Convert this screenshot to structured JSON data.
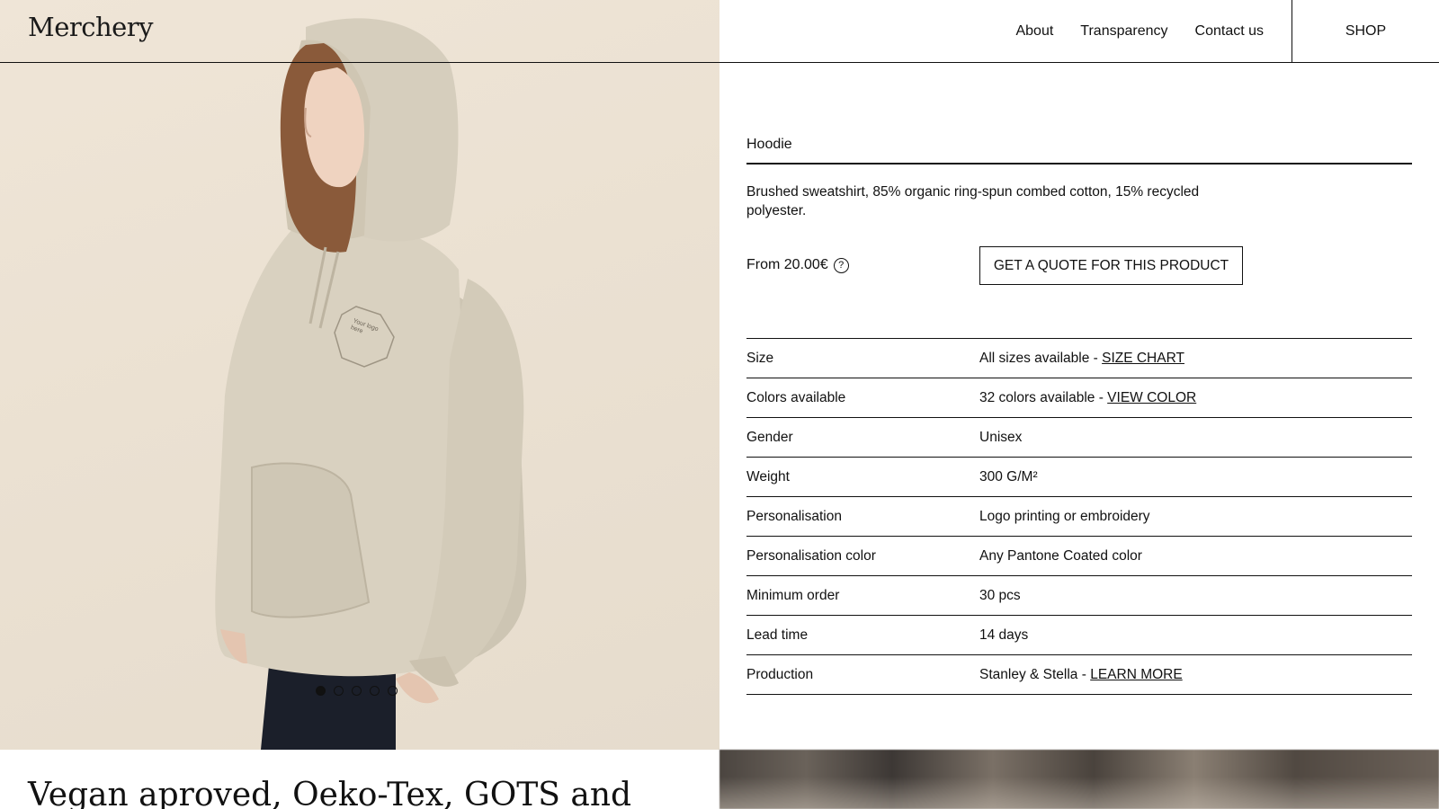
{
  "brand": {
    "logo": "Merchery"
  },
  "nav": {
    "items": [
      "About",
      "Transparency",
      "Contact us"
    ],
    "shop_label": "SHOP"
  },
  "hero": {
    "print_text": "Your logo here",
    "carousel": {
      "count": 5,
      "active": 0
    }
  },
  "product": {
    "name": "Hoodie",
    "description": "Brushed sweatshirt, 85% organic ring-spun combed cotton, 15% recycled polyester.",
    "price": "From 20.00€",
    "quote_button": "GET A QUOTE FOR THIS PRODUCT",
    "specs": [
      {
        "label": "Size",
        "value": "All sizes available - ",
        "link": "SIZE CHART"
      },
      {
        "label": "Colors available",
        "value": "32 colors available - ",
        "link": "VIEW COLOR"
      },
      {
        "label": "Gender",
        "value": "Unisex"
      },
      {
        "label": "Weight",
        "value": "300 G/M²"
      },
      {
        "label": "Personalisation",
        "value": "Logo printing or embroidery"
      },
      {
        "label": "Personalisation color",
        "value": "Any Pantone Coated color"
      },
      {
        "label": "Minimum order",
        "value": "30 pcs"
      },
      {
        "label": "Lead time",
        "value": "14 days"
      },
      {
        "label": "Production",
        "value": "Stanley & Stella - ",
        "link": "LEARN MORE"
      }
    ]
  },
  "bottom": {
    "headline": "Vegan aproved, Oeko-Tex, GOTS and"
  },
  "colors": {
    "text": "#111111",
    "photo_bg": "#ebe1d2",
    "hoodie": "#d8d0bf"
  }
}
